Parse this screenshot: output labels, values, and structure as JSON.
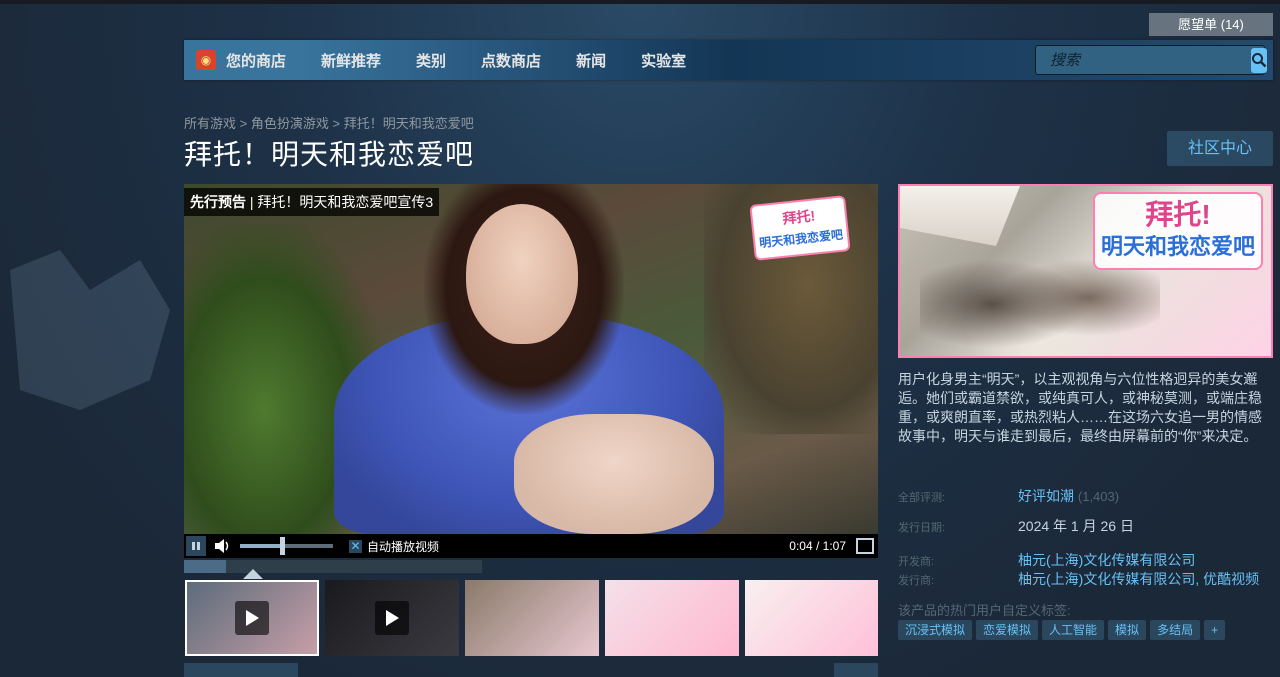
{
  "header": {
    "wishlist_label": "愿望单 (14)"
  },
  "nav": {
    "items": [
      "您的商店",
      "新鲜推荐",
      "类别",
      "点数商店",
      "新闻",
      "实验室"
    ],
    "search_placeholder": "搜索"
  },
  "breadcrumb": {
    "items": [
      "所有游戏",
      "角色扮演游戏",
      "拜托！明天和我恋爱吧"
    ],
    "separator": " > "
  },
  "page": {
    "title": "拜托！明天和我恋爱吧",
    "community_hub_label": "社区中心"
  },
  "video": {
    "caption_tag": "先行预告",
    "caption_text": " | 拜托！明天和我恋爱吧宣传3",
    "logo_main": "拜托!",
    "logo_sub": "明天和我恋爱吧",
    "autoplay_label": "自动播放视频",
    "time": "0:04 / 1:07",
    "volume_level": 0.45,
    "progress": 0.14
  },
  "thumbnails": [
    {
      "type": "video",
      "colors": [
        "#5a6a7a",
        "#c8a0a8"
      ]
    },
    {
      "type": "video",
      "colors": [
        "#1a1a1e",
        "#3a3a40"
      ]
    },
    {
      "type": "image",
      "colors": [
        "#8a7a6a",
        "#e8c8d0"
      ]
    },
    {
      "type": "image",
      "colors": [
        "#f4e0e8",
        "#ffb8d0"
      ]
    },
    {
      "type": "image",
      "colors": [
        "#f8f0f0",
        "#ffc0d8"
      ]
    }
  ],
  "capsule": {
    "title_main": "拜托!",
    "title_sub": "明天和我恋爱吧"
  },
  "description": "用户化身男主“明天”，以主观视角与六位性格迥异的美女邂逅。她们或霸道禁欲，或纯真可人，或神秘莫测，或端庄稳重，或爽朗直率，或热烈粘人……在这场六女追一男的情感故事中，明天与谁走到最后，最终由屏幕前的“你”来决定。",
  "info": {
    "reviews_label": "全部评测:",
    "reviews_value": "好评如潮",
    "reviews_count": "(1,403)",
    "release_label": "发行日期:",
    "release_value": "2024 年 1 月 26 日",
    "developer_label": "开发商:",
    "developer_value": "柚元(上海)文化传媒有限公司",
    "publisher_label": "发行商:",
    "publisher_value_1": "柚元(上海)文化传媒有限公司",
    "publisher_sep": ", ",
    "publisher_value_2": "优酷视频"
  },
  "tags": {
    "label": "该产品的热门用户自定义标签:",
    "items": [
      "沉浸式模拟",
      "恋爱模拟",
      "人工智能",
      "模拟",
      "多结局",
      "+"
    ]
  },
  "colors": {
    "background": "#1b2838",
    "link": "#66c0f4",
    "tag_bg": "#2a475e",
    "muted": "#556772"
  }
}
